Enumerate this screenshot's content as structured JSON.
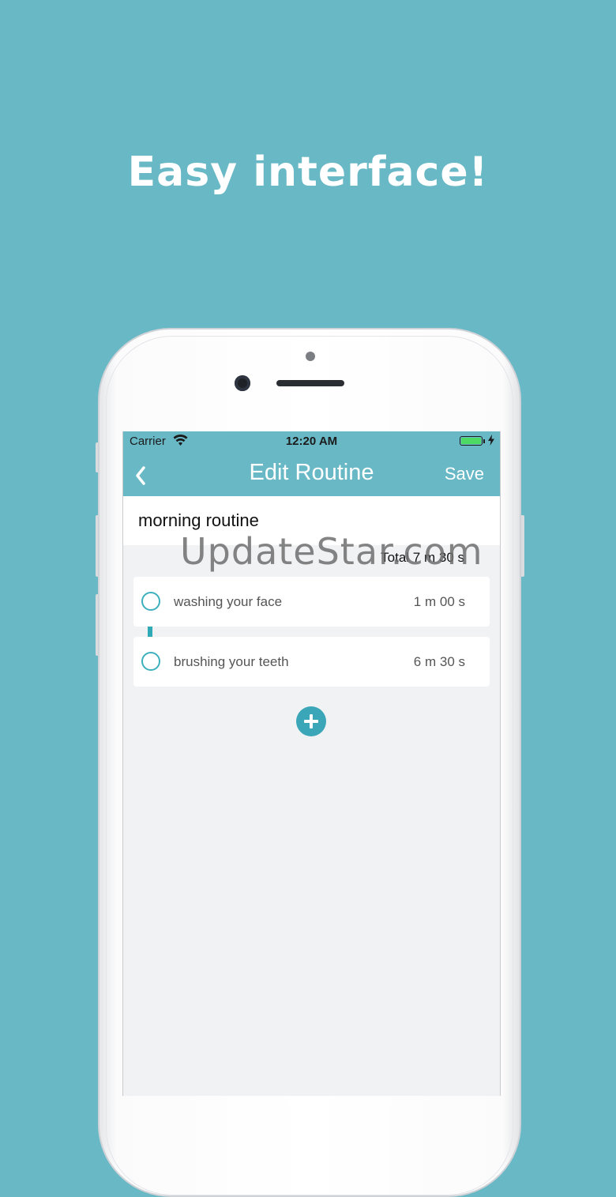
{
  "banner": {
    "headline": "Easy interface!"
  },
  "status_bar": {
    "carrier": "Carrier",
    "time": "12:20 AM",
    "wifi_icon": "wifi-icon",
    "battery_icon": "battery-charging-icon"
  },
  "nav": {
    "back_icon": "chevron-left-icon",
    "title": "Edit Routine",
    "save_label": "Save"
  },
  "routine": {
    "name": "morning routine",
    "total": "Total 7 m 30 s",
    "steps": [
      {
        "label": "washing your face",
        "time": "1 m 00 s"
      },
      {
        "label": "brushing your teeth",
        "time": "6 m 30 s"
      }
    ],
    "add_icon": "plus-icon"
  },
  "watermark": "UpdateStar.com",
  "colors": {
    "background": "#69b8c6",
    "accent": "#3aa6b8",
    "screen_bg": "#f1f2f4"
  }
}
